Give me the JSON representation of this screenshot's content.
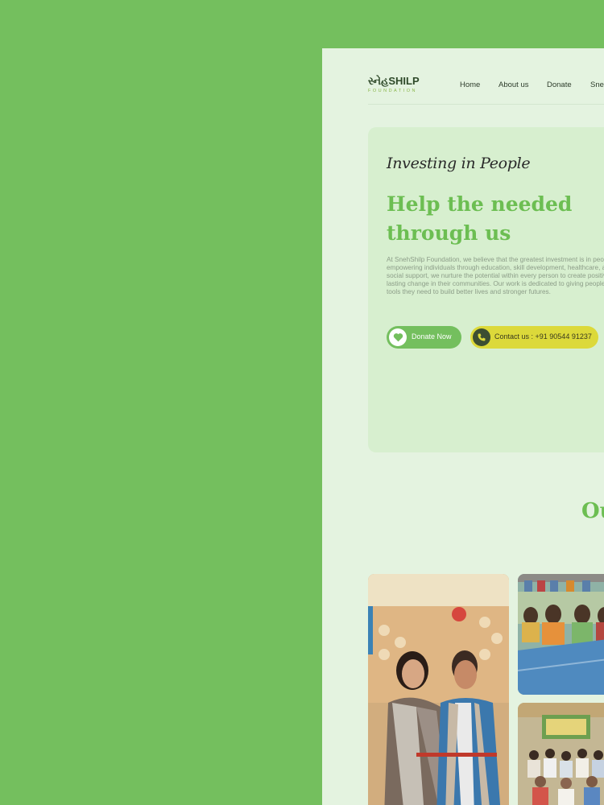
{
  "brand": {
    "logo_main": "સ્નેહSHILP",
    "logo_sub": "FOUNDATION",
    "accent": "#74bf5e",
    "yellow": "#dcd93a"
  },
  "nav": {
    "items": [
      "Home",
      "About us",
      "Donate",
      "Sne"
    ]
  },
  "hero": {
    "tagline": "Investing in People",
    "headline": "Help the needed through us",
    "description": "At SnehShilp Foundation, we believe that the greatest investment is in people. By empowering individuals through education, skill development, healthcare, and social support, we nurture the potential within every person to create positive, lasting change in their communities. Our work is dedicated to giving people the tools they need to build better lives and stronger futures.",
    "donate_label": "Donate Now",
    "donate_icon": "heart-icon",
    "contact_label": "Contact us : +91 90544 91237",
    "contact_icon": "phone-icon"
  },
  "section": {
    "title": "Ou"
  },
  "gallery": {
    "photos": [
      "couple-ribbon-cutting-photo",
      "women-at-table-photo",
      "group-under-banner-photo"
    ]
  }
}
